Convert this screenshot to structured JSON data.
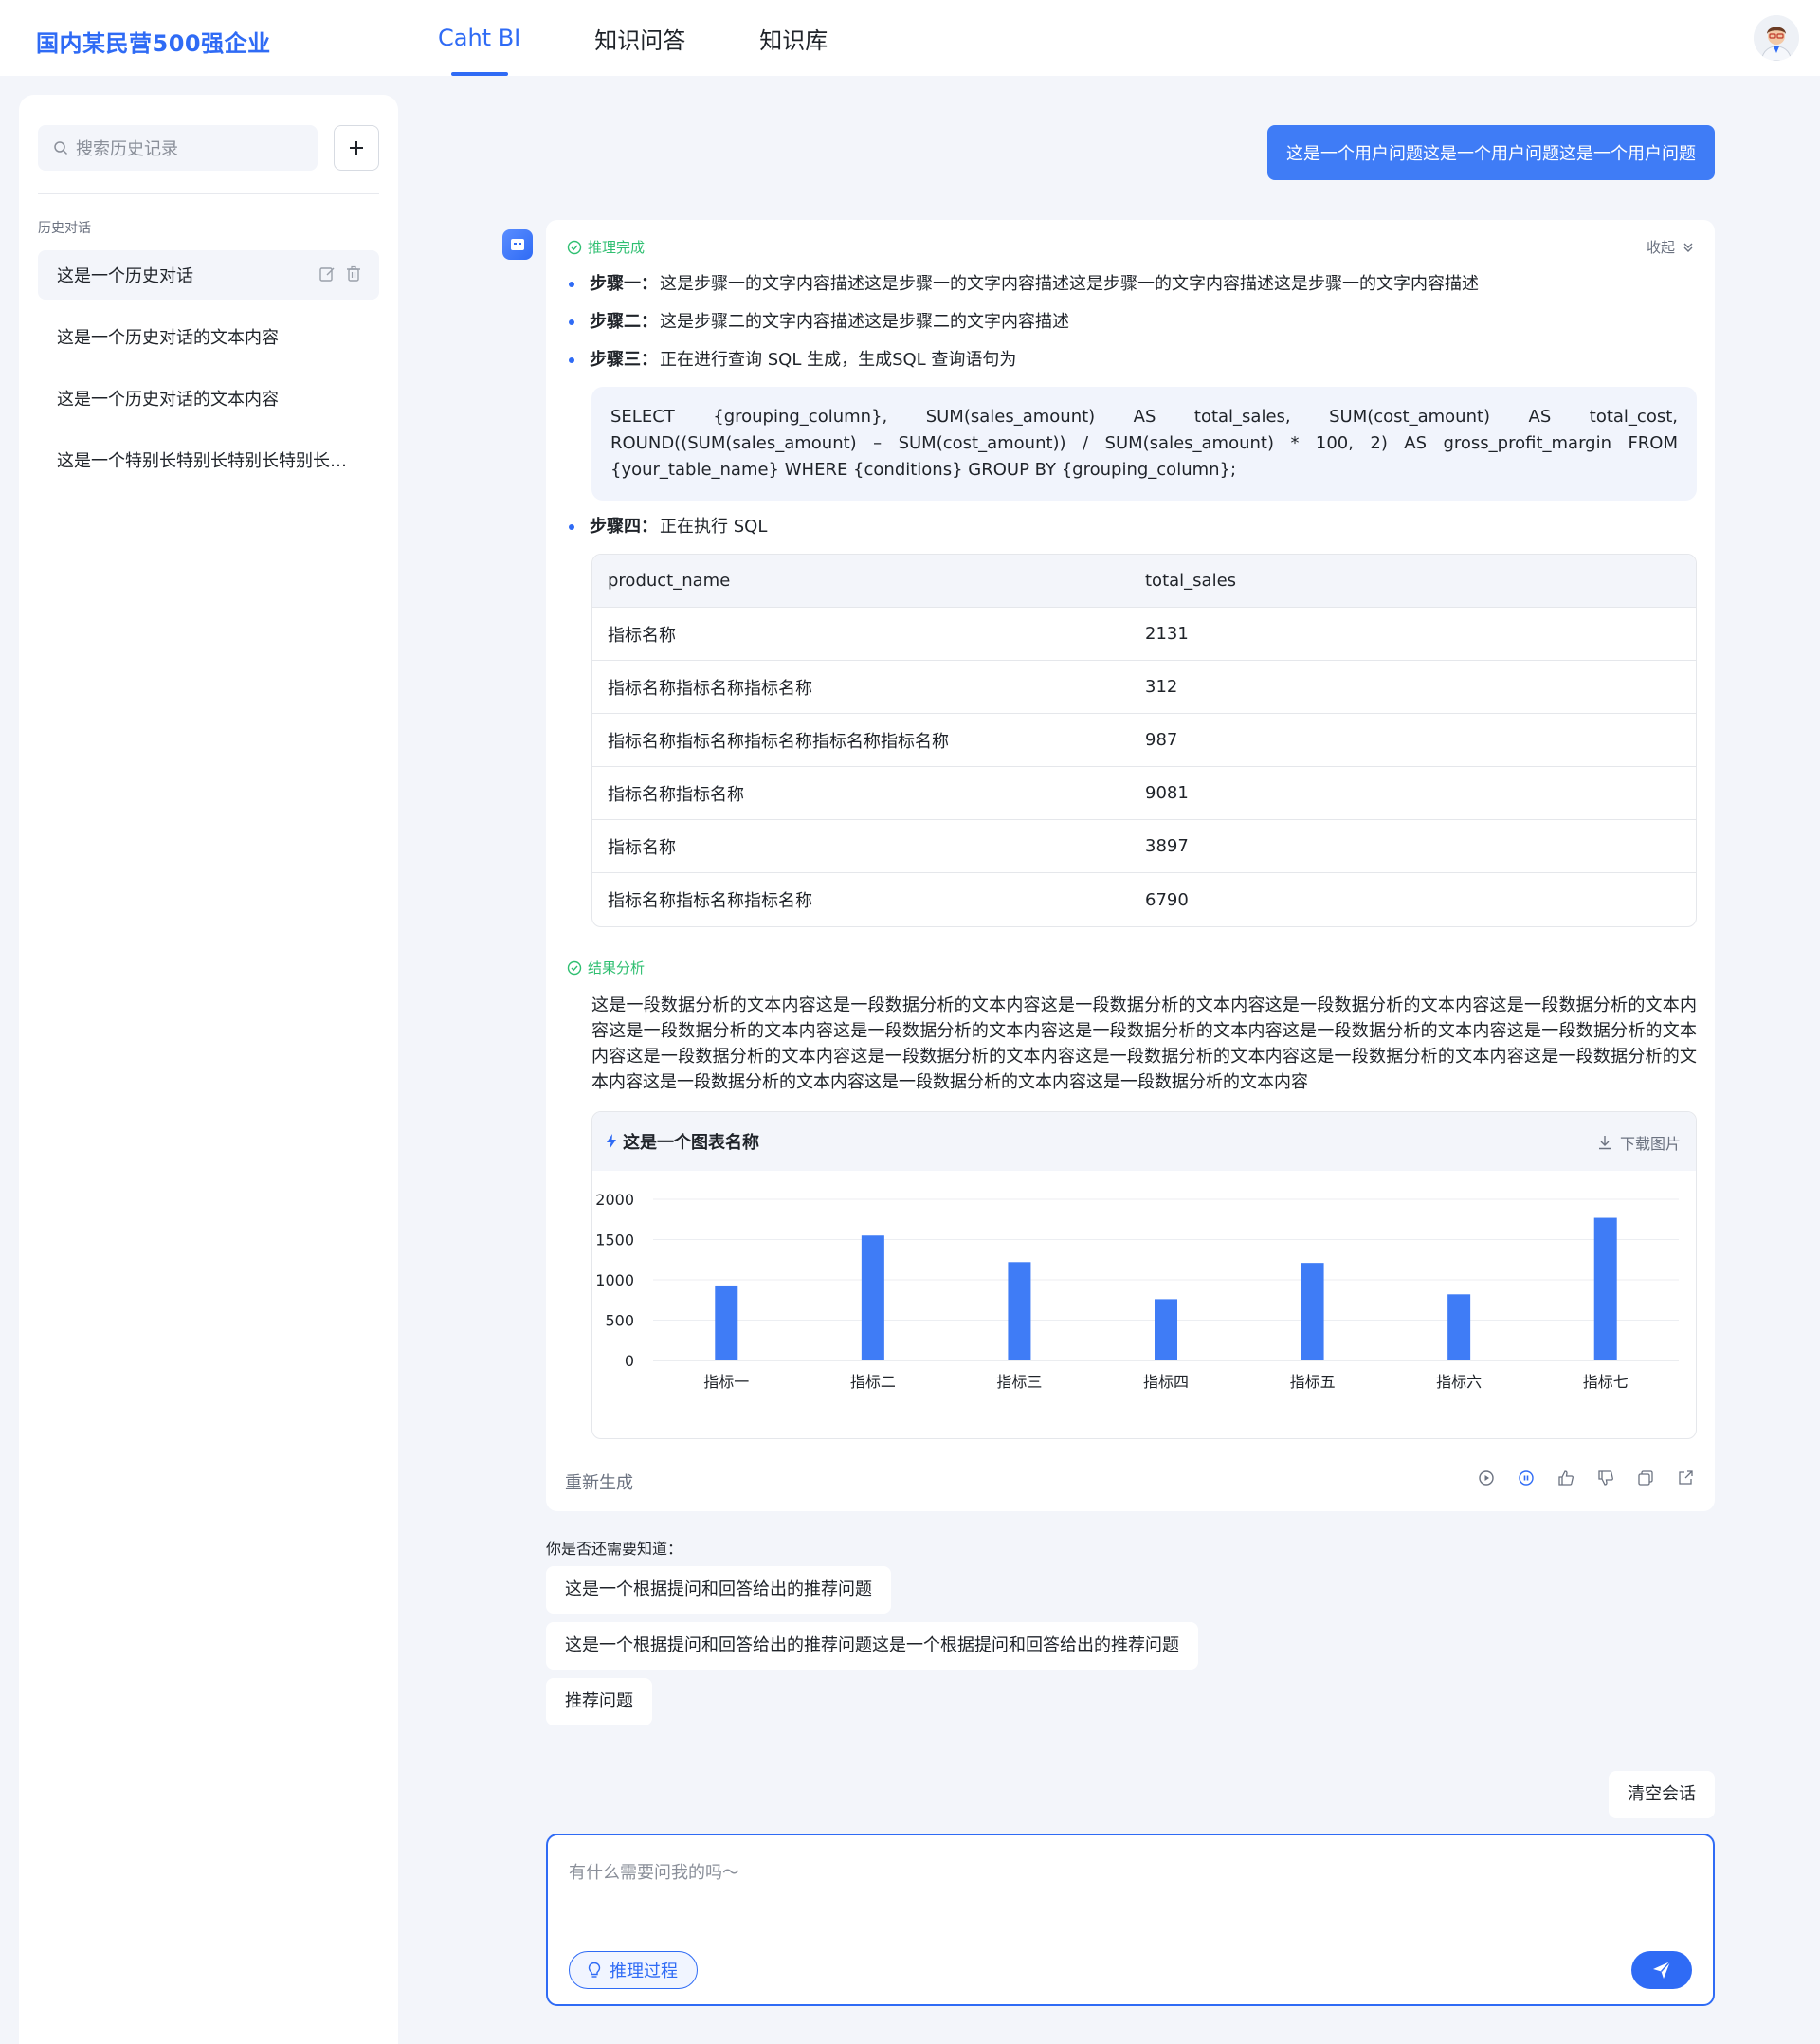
{
  "header": {
    "brand": "国内某民营500强企业",
    "tabs": [
      {
        "label": "Caht BI",
        "active": true
      },
      {
        "label": "知识问答",
        "active": false
      },
      {
        "label": "知识库",
        "active": false
      }
    ],
    "accent_color": "#2f6bf5"
  },
  "sidebar": {
    "search_placeholder": "搜索历史记录",
    "history_heading": "历史对话",
    "items": [
      {
        "label": "这是一个历史对话",
        "active": true
      },
      {
        "label": "这是一个历史对话的文本内容",
        "active": false
      },
      {
        "label": "这是一个历史对话的文本内容",
        "active": false
      },
      {
        "label": "这是一个特别长特别长特别长特别长特别长特别长",
        "active": false
      }
    ]
  },
  "chat": {
    "user_question": "这是一个用户问题这是一个用户问题这是一个用户问题",
    "answer": {
      "status": "推理完成",
      "collapse_label": "收起",
      "steps": [
        {
          "label": "步骤一：",
          "text": "这是步骤一的文字内容描述这是步骤一的文字内容描述这是步骤一的文字内容描述这是步骤一的文字内容描述"
        },
        {
          "label": "步骤二：",
          "text": "这是步骤二的文字内容描述这是步骤二的文字内容描述"
        },
        {
          "label": "步骤三：",
          "text": "正在进行查询 SQL 生成，生成SQL 查询语句为"
        },
        {
          "label": "步骤四：",
          "text": "正在执行 SQL"
        }
      ],
      "sql": "SELECT {grouping_column}, SUM(sales_amount) AS total_sales, SUM(cost_amount) AS total_cost, ROUND((SUM(sales_amount) – SUM(cost_amount)) / SUM(sales_amount) * 100, 2) AS gross_profit_margin FROM {your_table_name} WHERE {conditions} GROUP BY {grouping_column};",
      "table": {
        "columns": [
          "product_name",
          "total_sales"
        ],
        "rows": [
          [
            "指标名称",
            "2131"
          ],
          [
            "指标名称指标名称指标名称",
            "312"
          ],
          [
            "指标名称指标名称指标名称指标名称指标名称",
            "987"
          ],
          [
            "指标名称指标名称",
            "9081"
          ],
          [
            "指标名称",
            "3897"
          ],
          [
            "指标名称指标名称指标名称",
            "6790"
          ]
        ]
      },
      "analysis_heading": "结果分析",
      "analysis_text": "这是一段数据分析的文本内容这是一段数据分析的文本内容这是一段数据分析的文本内容这是一段数据分析的文本内容这是一段数据分析的文本内容这是一段数据分析的文本内容这是一段数据分析的文本内容这是一段数据分析的文本内容这是一段数据分析的文本内容这是一段数据分析的文本内容这是一段数据分析的文本内容这是一段数据分析的文本内容这是一段数据分析的文本内容这是一段数据分析的文本内容这是一段数据分析的文本内容这是一段数据分析的文本内容这是一段数据分析的文本内容这是一段数据分析的文本内容",
      "chart_title": "这是一个图表名称",
      "download_label": "下载图片",
      "regenerate_label": "重新生成"
    },
    "suggestions_title": "你是否还需要知道：",
    "suggestions": [
      "这是一个根据提问和回答给出的推荐问题",
      "这是一个根据提问和回答给出的推荐问题这是一个根据提问和回答给出的推荐问题",
      "推荐问题"
    ],
    "clear_label": "清空会话",
    "input_placeholder": "有什么需要问我的吗～",
    "reasoning_label": "推理过程"
  },
  "chart_data": {
    "type": "bar",
    "title": "这是一个图表名称",
    "categories": [
      "指标一",
      "指标二",
      "指标三",
      "指标四",
      "指标五",
      "指标六",
      "指标七"
    ],
    "values": [
      930,
      1550,
      1220,
      760,
      1210,
      820,
      1770
    ],
    "ylim": [
      0,
      2000
    ],
    "yticks": [
      0,
      500,
      1000,
      1500,
      2000
    ],
    "grid": true,
    "bar_color": "#3f7cf6"
  }
}
